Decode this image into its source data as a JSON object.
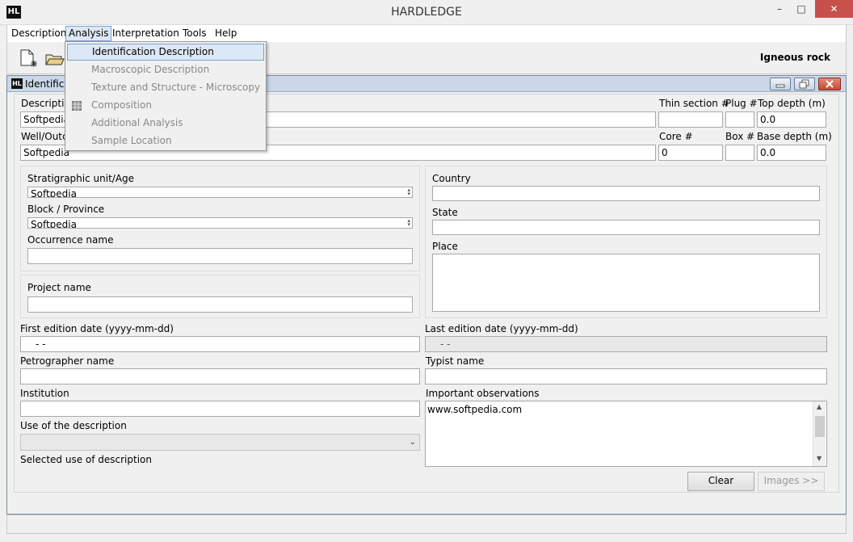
{
  "window": {
    "title": "HARDLEDGE",
    "logo": "HL",
    "minimize_glyph": "–",
    "maximize_glyph": "□",
    "close_glyph": "✕"
  },
  "menubar": {
    "items": [
      "Description",
      "Analysis",
      "Interpretation",
      "Tools",
      "Help"
    ],
    "active": "Analysis"
  },
  "analysis_menu": {
    "items": [
      "Identification Description",
      "Macroscopic Description",
      "Texture and Structure - Microscopy",
      "Composition",
      "Additional Analysis",
      "Sample Location"
    ],
    "highlighted": "Identification Description",
    "composition_icon": "grid-icon"
  },
  "toolbar": {
    "icons": [
      "new-document-icon",
      "open-folder-icon"
    ],
    "rock_type": "Igneous rock"
  },
  "inner_window": {
    "title": "Identifica",
    "logo": "HL"
  },
  "form": {
    "description_label": "Descriptio",
    "description_value": "Softpedia",
    "well_label": "Well/Outc",
    "well_value": "Softpedia",
    "thin_section_label": "Thin section #",
    "plug_label": "Plug #",
    "top_depth_label": "Top depth (m)",
    "top_depth_value": "0.0",
    "core_label": "Core #",
    "core_value": "0",
    "box_label": "Box #",
    "base_depth_label": "Base depth (m)",
    "base_depth_value": "0.0",
    "strat_label": "Stratigraphic unit/Age",
    "strat_value": "Softpedia",
    "block_label": "Block / Province",
    "block_value": "Softpedia",
    "occurrence_label": "Occurrence name",
    "project_label": "Project name",
    "country_label": "Country",
    "state_label": "State",
    "place_label": "Place",
    "first_edition_label": "First edition date (yyyy-mm-dd)",
    "first_edition_value": "- -",
    "last_edition_label": "Last edition date (yyyy-mm-dd)",
    "last_edition_value": "- -",
    "petrographer_label": "Petrographer name",
    "typist_label": "Typist name",
    "institution_label": "Institution",
    "observations_label": "Important observations",
    "observations_value": "www.softpedia.com",
    "use_label": "Use of the description",
    "selected_use_label": "Selected use of description",
    "clear_button": "Clear",
    "images_button": "Images >>"
  }
}
